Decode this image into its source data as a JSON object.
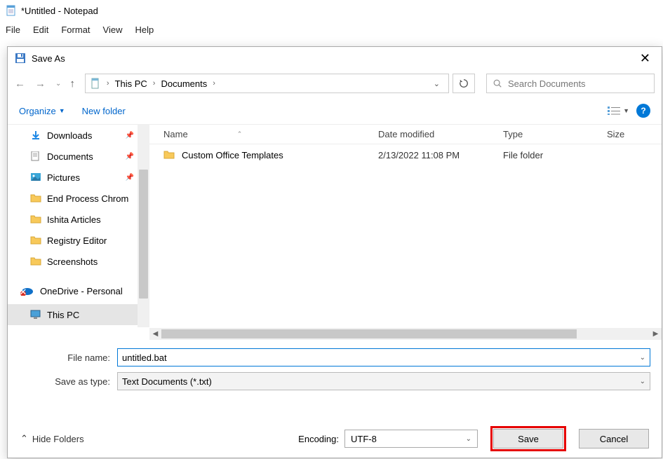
{
  "app": {
    "title": "*Untitled - Notepad",
    "menu": [
      "File",
      "Edit",
      "Format",
      "View",
      "Help"
    ]
  },
  "dialog": {
    "title": "Save As",
    "breadcrumb": {
      "root": "This PC",
      "current": "Documents"
    },
    "search_placeholder": "Search Documents",
    "organize": "Organize",
    "new_folder": "New folder",
    "help_symbol": "?",
    "sidebar": {
      "items": [
        {
          "label": "Downloads",
          "icon": "download",
          "pinned": true
        },
        {
          "label": "Documents",
          "icon": "document",
          "pinned": true
        },
        {
          "label": "Pictures",
          "icon": "pictures",
          "pinned": true
        },
        {
          "label": "End Process Chrom",
          "icon": "folder",
          "pinned": false
        },
        {
          "label": "Ishita Articles",
          "icon": "folder",
          "pinned": false
        },
        {
          "label": "Registry Editor",
          "icon": "folder",
          "pinned": false
        },
        {
          "label": "Screenshots",
          "icon": "folder",
          "pinned": false
        }
      ],
      "onedrive": "OneDrive - Personal",
      "thispc": "This PC"
    },
    "columns": {
      "name": "Name",
      "date": "Date modified",
      "type": "Type",
      "size": "Size"
    },
    "rows": [
      {
        "name": "Custom Office Templates",
        "date": "2/13/2022 11:08 PM",
        "type": "File folder"
      }
    ],
    "fields": {
      "filename_label": "File name:",
      "filename_value": "untitled.bat",
      "saveastype_label": "Save as type:",
      "saveastype_value": "Text Documents (*.txt)"
    },
    "footer": {
      "hide_folders": "Hide Folders",
      "encoding_label": "Encoding:",
      "encoding_value": "UTF-8",
      "save": "Save",
      "cancel": "Cancel"
    }
  }
}
